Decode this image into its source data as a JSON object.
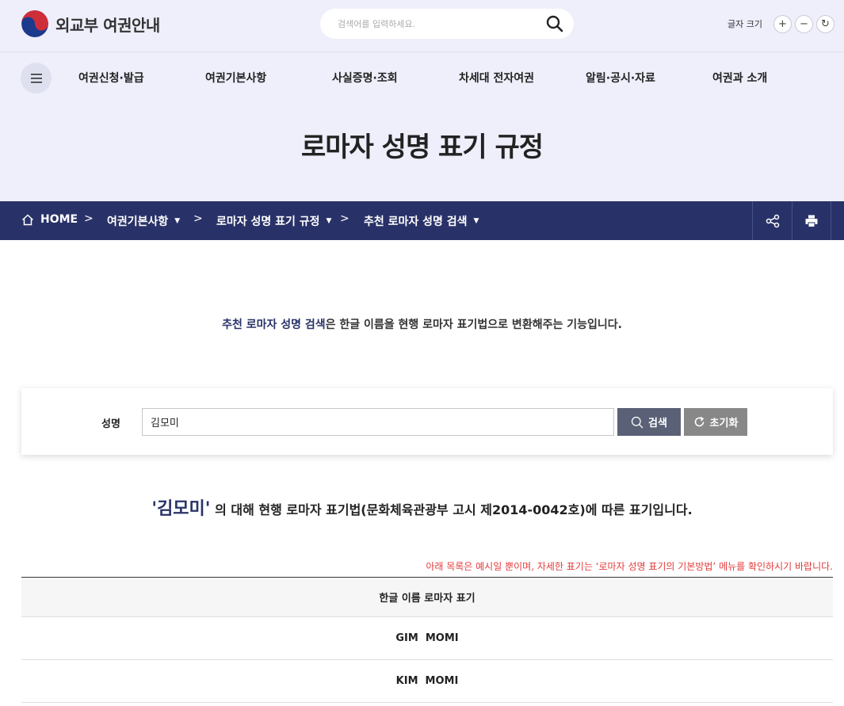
{
  "header": {
    "logo_text": "외교부 여권안내",
    "search_placeholder": "검색어를 입력하세요.",
    "font_size_label": "글자 크기",
    "font_buttons": [
      "+",
      "−",
      "↻"
    ]
  },
  "nav": {
    "items": [
      "여권신청·발급",
      "여권기본사항",
      "사실증명·조회",
      "차세대 전자여권",
      "알림·공시·자료",
      "여권과 소개"
    ]
  },
  "page_title": "로마자 성명 표기 규정",
  "breadcrumb": {
    "home": "HOME",
    "items": [
      "여권기본사항",
      "로마자 성명 표기 규정",
      "추천 로마자 성명 검색"
    ]
  },
  "intro": {
    "highlight": "추천 로마자 성명 검색",
    "rest": "은 한글 이름을 현행 로마자 표기법으로 변환해주는 기능입니다."
  },
  "search_form": {
    "label": "성명",
    "value": "김모미",
    "search_label": "검색",
    "reset_label": "초기화"
  },
  "result": {
    "name": "'김모미'",
    "text": " 의 대해 현행 로마자 표기법(문화체육관광부 고시 제2014-0042호)에 따른 표기입니다."
  },
  "notice": "아래 목록은 예시일 뿐이며, 자세한 표기는 ‘로마자 성명 표기의 기본방법’ 메뉴를 확인하시기 바랍니다.",
  "table": {
    "header": "한글 이름 로마자 표기",
    "rows": [
      "GIM  MOMI",
      "KIM  MOMI"
    ]
  },
  "colors": {
    "header_bg": "#eeeffb",
    "navy": "#293268",
    "notice_red": "#e23b3b",
    "search_btn": "#5a6176",
    "reset_btn": "#888888"
  }
}
